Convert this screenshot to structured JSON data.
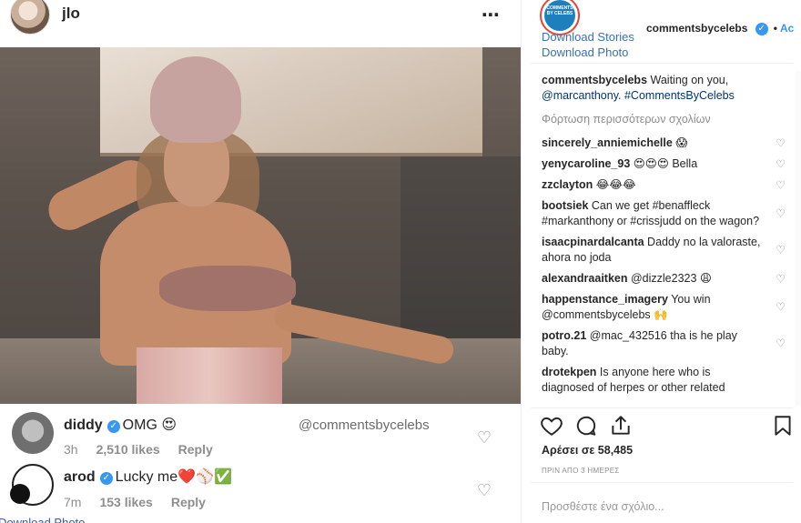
{
  "post": {
    "author": "jlo",
    "more_icon": "⋯"
  },
  "watermark": "@commentsbycelebs",
  "left_comments": [
    {
      "user": "diddy",
      "text": "OMG 😍",
      "time": "3h",
      "likes": "2,510 likes",
      "reply": "Reply"
    },
    {
      "user": "arod",
      "text": "Lucky me❤️⚾✅",
      "time": "7m",
      "likes": "153 likes",
      "reply": "Reply"
    }
  ],
  "left_download": "Download Photo",
  "right": {
    "avatar_text": "COMMENTS BY CELEBS",
    "username": "commentsbycelebs",
    "follow": "Ac",
    "download_stories": "Download Stories",
    "download_photo": "Download Photo",
    "caption_user": "commentsbycelebs",
    "caption_text": "Waiting on you,",
    "caption_mention": "@marcanthony",
    "caption_tag": "#CommentsByCelebs",
    "load_more": "Φόρτωση περισσότερων σχολίων",
    "comments": [
      {
        "user": "sincerely_anniemichelle",
        "text": "😱"
      },
      {
        "user": "yenycaroline_93",
        "text": "😍😍😍 Bella"
      },
      {
        "user": "zzclayton",
        "text": "😂😂😂"
      },
      {
        "user": "bootsiek",
        "text": "Can we get #benaffleck #markanthony or #crissjudd on the wagon?"
      },
      {
        "user": "isaacpinardalcanta",
        "text": "Daddy no la valoraste, ahora no joda"
      },
      {
        "user": "alexandraaitken",
        "text": "@dizzle2323 😩"
      },
      {
        "user": "happenstance_imagery",
        "text": "You win @commentsbycelebs 🙌"
      },
      {
        "user": "potro.21",
        "text": "@mac_432516 tha is he play baby."
      },
      {
        "user": "drotekpen",
        "text": "Is anyone here who is diagnosed of herpes or other related"
      }
    ],
    "likes": "Αρέσει σε 58,485",
    "time_ago": "ΠΡΙΝ ΑΠΟ 3 ΗΜΕΡΕΣ",
    "add_comment_placeholder": "Προσθέστε ένα σχόλιο..."
  }
}
